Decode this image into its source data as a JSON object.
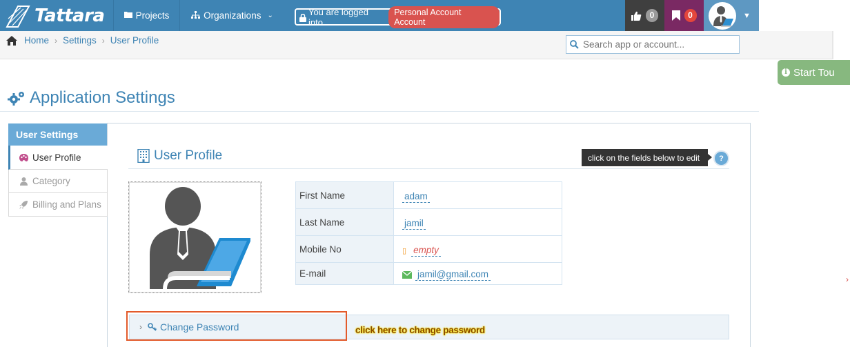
{
  "brand": {
    "name": "Tattara"
  },
  "nav": {
    "projects_label": "Projects",
    "organizations_label": "Organizations",
    "logged_in_prefix": "You are logged into",
    "account_name": "Personal Account Account",
    "likes_count": "0",
    "bookmarks_count": "0"
  },
  "breadcrumb": [
    "Home",
    "Settings",
    "User Profile"
  ],
  "search": {
    "placeholder": "Search app or account..."
  },
  "tour": {
    "label": "Start Tou"
  },
  "page": {
    "title": "Application Settings"
  },
  "sidebar": {
    "header": "User Settings",
    "items": [
      {
        "label": "User Profile",
        "icon": "palette-icon",
        "active": true
      },
      {
        "label": "Category",
        "icon": "user-icon",
        "active": false
      },
      {
        "label": "Billing and Plans",
        "icon": "rocket-icon",
        "active": false
      }
    ]
  },
  "profile": {
    "section_title": "User Profile",
    "tip": "click on the fields below to edit",
    "help": "?",
    "fields": [
      {
        "label": "First Name",
        "value": "adam"
      },
      {
        "label": "Last Name",
        "value": "jamil"
      },
      {
        "label": "Mobile No",
        "value": "empty"
      },
      {
        "label": "E-mail",
        "value": "jamil@gmail.com"
      }
    ]
  },
  "password": {
    "label": "Change Password",
    "annotation": "click here to change password"
  },
  "colors": {
    "navbar": "#3e84b4",
    "accent": "#3e84b4",
    "danger": "#d9534f",
    "tour": "#87b87f",
    "highlight": "#e35a2a"
  }
}
